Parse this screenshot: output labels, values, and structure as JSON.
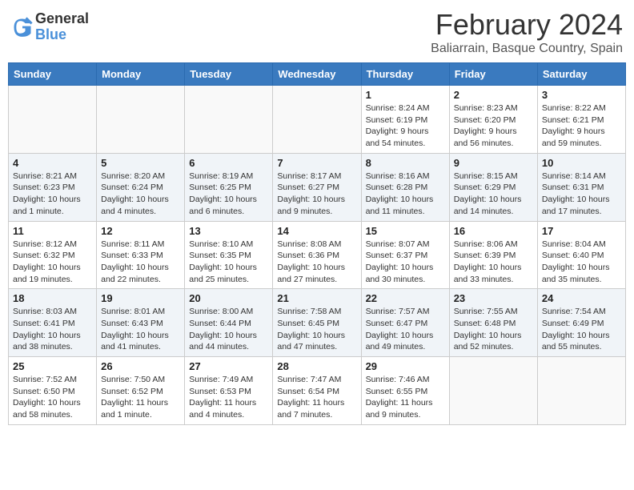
{
  "logo": {
    "general": "General",
    "blue": "Blue"
  },
  "title": "February 2024",
  "subtitle": "Baliarrain, Basque Country, Spain",
  "days_of_week": [
    "Sunday",
    "Monday",
    "Tuesday",
    "Wednesday",
    "Thursday",
    "Friday",
    "Saturday"
  ],
  "weeks": [
    [
      {
        "day": "",
        "info": ""
      },
      {
        "day": "",
        "info": ""
      },
      {
        "day": "",
        "info": ""
      },
      {
        "day": "",
        "info": ""
      },
      {
        "day": "1",
        "info": "Sunrise: 8:24 AM\nSunset: 6:19 PM\nDaylight: 9 hours\nand 54 minutes."
      },
      {
        "day": "2",
        "info": "Sunrise: 8:23 AM\nSunset: 6:20 PM\nDaylight: 9 hours\nand 56 minutes."
      },
      {
        "day": "3",
        "info": "Sunrise: 8:22 AM\nSunset: 6:21 PM\nDaylight: 9 hours\nand 59 minutes."
      }
    ],
    [
      {
        "day": "4",
        "info": "Sunrise: 8:21 AM\nSunset: 6:23 PM\nDaylight: 10 hours\nand 1 minute."
      },
      {
        "day": "5",
        "info": "Sunrise: 8:20 AM\nSunset: 6:24 PM\nDaylight: 10 hours\nand 4 minutes."
      },
      {
        "day": "6",
        "info": "Sunrise: 8:19 AM\nSunset: 6:25 PM\nDaylight: 10 hours\nand 6 minutes."
      },
      {
        "day": "7",
        "info": "Sunrise: 8:17 AM\nSunset: 6:27 PM\nDaylight: 10 hours\nand 9 minutes."
      },
      {
        "day": "8",
        "info": "Sunrise: 8:16 AM\nSunset: 6:28 PM\nDaylight: 10 hours\nand 11 minutes."
      },
      {
        "day": "9",
        "info": "Sunrise: 8:15 AM\nSunset: 6:29 PM\nDaylight: 10 hours\nand 14 minutes."
      },
      {
        "day": "10",
        "info": "Sunrise: 8:14 AM\nSunset: 6:31 PM\nDaylight: 10 hours\nand 17 minutes."
      }
    ],
    [
      {
        "day": "11",
        "info": "Sunrise: 8:12 AM\nSunset: 6:32 PM\nDaylight: 10 hours\nand 19 minutes."
      },
      {
        "day": "12",
        "info": "Sunrise: 8:11 AM\nSunset: 6:33 PM\nDaylight: 10 hours\nand 22 minutes."
      },
      {
        "day": "13",
        "info": "Sunrise: 8:10 AM\nSunset: 6:35 PM\nDaylight: 10 hours\nand 25 minutes."
      },
      {
        "day": "14",
        "info": "Sunrise: 8:08 AM\nSunset: 6:36 PM\nDaylight: 10 hours\nand 27 minutes."
      },
      {
        "day": "15",
        "info": "Sunrise: 8:07 AM\nSunset: 6:37 PM\nDaylight: 10 hours\nand 30 minutes."
      },
      {
        "day": "16",
        "info": "Sunrise: 8:06 AM\nSunset: 6:39 PM\nDaylight: 10 hours\nand 33 minutes."
      },
      {
        "day": "17",
        "info": "Sunrise: 8:04 AM\nSunset: 6:40 PM\nDaylight: 10 hours\nand 35 minutes."
      }
    ],
    [
      {
        "day": "18",
        "info": "Sunrise: 8:03 AM\nSunset: 6:41 PM\nDaylight: 10 hours\nand 38 minutes."
      },
      {
        "day": "19",
        "info": "Sunrise: 8:01 AM\nSunset: 6:43 PM\nDaylight: 10 hours\nand 41 minutes."
      },
      {
        "day": "20",
        "info": "Sunrise: 8:00 AM\nSunset: 6:44 PM\nDaylight: 10 hours\nand 44 minutes."
      },
      {
        "day": "21",
        "info": "Sunrise: 7:58 AM\nSunset: 6:45 PM\nDaylight: 10 hours\nand 47 minutes."
      },
      {
        "day": "22",
        "info": "Sunrise: 7:57 AM\nSunset: 6:47 PM\nDaylight: 10 hours\nand 49 minutes."
      },
      {
        "day": "23",
        "info": "Sunrise: 7:55 AM\nSunset: 6:48 PM\nDaylight: 10 hours\nand 52 minutes."
      },
      {
        "day": "24",
        "info": "Sunrise: 7:54 AM\nSunset: 6:49 PM\nDaylight: 10 hours\nand 55 minutes."
      }
    ],
    [
      {
        "day": "25",
        "info": "Sunrise: 7:52 AM\nSunset: 6:50 PM\nDaylight: 10 hours\nand 58 minutes."
      },
      {
        "day": "26",
        "info": "Sunrise: 7:50 AM\nSunset: 6:52 PM\nDaylight: 11 hours\nand 1 minute."
      },
      {
        "day": "27",
        "info": "Sunrise: 7:49 AM\nSunset: 6:53 PM\nDaylight: 11 hours\nand 4 minutes."
      },
      {
        "day": "28",
        "info": "Sunrise: 7:47 AM\nSunset: 6:54 PM\nDaylight: 11 hours\nand 7 minutes."
      },
      {
        "day": "29",
        "info": "Sunrise: 7:46 AM\nSunset: 6:55 PM\nDaylight: 11 hours\nand 9 minutes."
      },
      {
        "day": "",
        "info": ""
      },
      {
        "day": "",
        "info": ""
      }
    ]
  ]
}
